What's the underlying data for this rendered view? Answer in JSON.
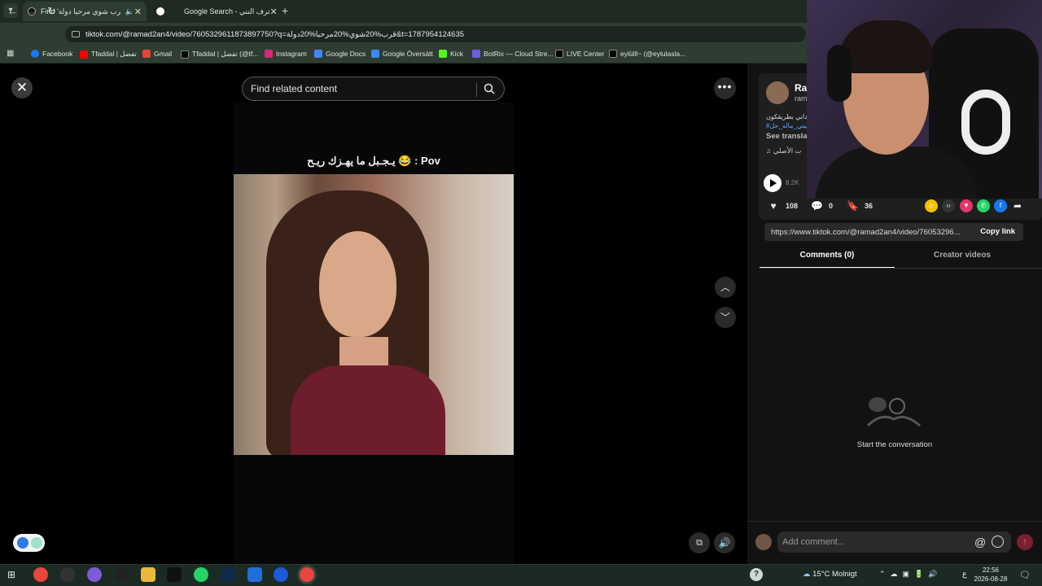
{
  "browser": {
    "tabs": [
      {
        "title": "Find 'قرب شوي مرحبا دولة' o",
        "active": true
      },
      {
        "title": "Google Search - ترف النني",
        "active": false
      }
    ],
    "url": "tiktok.com/@ramad2an4/video/7605329611873897750?q=قرب%20شوي%20مرحبا%20دولة&t=1787954124635",
    "bookmarks": [
      {
        "label": "Facebook",
        "color": "#1877f2"
      },
      {
        "label": "Tfaddal | تفضل",
        "color": "#ff0000"
      },
      {
        "label": "Gmail",
        "color": "#ea4335"
      },
      {
        "label": "Tfaddal | تفضل (@tf...",
        "color": "#000000"
      },
      {
        "label": "Instagram",
        "color": "#d62976"
      },
      {
        "label": "Google Docs",
        "color": "#4285f4"
      },
      {
        "label": "Google Översätt",
        "color": "#4285f4"
      },
      {
        "label": "Kick",
        "color": "#53fc18"
      },
      {
        "label": "BotRix — Cloud Stre...",
        "color": "#6c5ce7"
      },
      {
        "label": "LIVE Center",
        "color": "#000000"
      },
      {
        "label": "eylülll~ (@eylulasla...",
        "color": "#000000"
      }
    ]
  },
  "tiktok": {
    "search_placeholder": "Find related content",
    "video_caption": "يـجـبل ما يهـزك ريـح 😂 : Pov",
    "author": {
      "name": "Ra",
      "handle": "ram"
    },
    "description": "ـعوداني بطريقكون",
    "hashtag": "#ـيتي_ماله_حل",
    "see_translation": "See transla",
    "music": "♫  ت الأصلي",
    "plays": "8.2K",
    "likes": "108",
    "comments_count": "0",
    "saves": "36",
    "share_link": "https://www.tiktok.com/@ramad2an4/video/76053296...",
    "copy_link": "Copy link",
    "tab_comments": "Comments (0)",
    "tab_creator": "Creator videos",
    "empty_state": "Start the conversation",
    "comment_placeholder": "Add comment..."
  },
  "taskbar": {
    "weather": "15°C  Molnigt",
    "time": "22:56",
    "date": "2026-08-28",
    "lang": "ع"
  }
}
